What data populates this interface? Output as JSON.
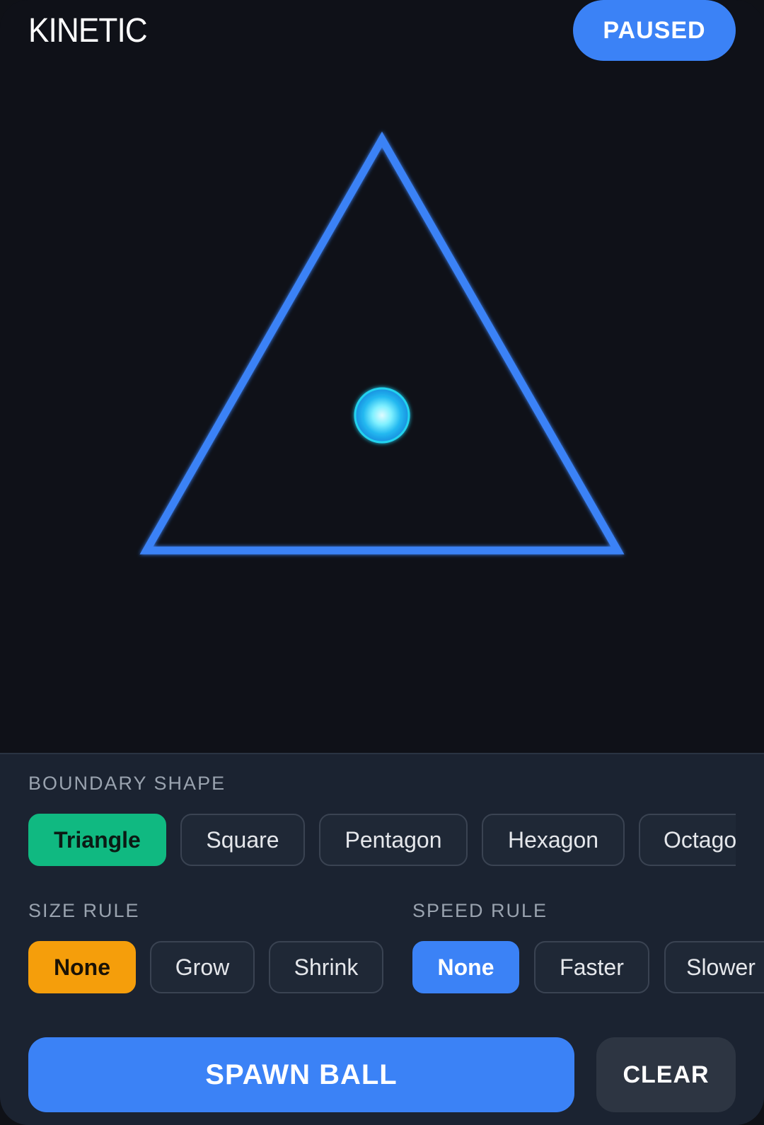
{
  "header": {
    "title": "KINETIC",
    "status": "PAUSED"
  },
  "stage": {
    "boundary_color": "#3b82f6",
    "ball_color": "#38bdf8"
  },
  "boundary_shape": {
    "label": "BOUNDARY SHAPE",
    "options": [
      "Triangle",
      "Square",
      "Pentagon",
      "Hexagon",
      "Octago"
    ],
    "selected": "Triangle"
  },
  "size_rule": {
    "label": "SIZE RULE",
    "options": [
      "None",
      "Grow",
      "Shrink"
    ],
    "selected": "None"
  },
  "speed_rule": {
    "label": "SPEED RULE",
    "options": [
      "None",
      "Faster",
      "Slower"
    ],
    "selected": "None"
  },
  "actions": {
    "spawn_label": "SPAWN BALL",
    "clear_label": "CLEAR"
  },
  "colors": {
    "accent_blue": "#3b82f6",
    "accent_green": "#10b981",
    "accent_orange": "#f59e0b",
    "background": "#0f1118",
    "panel": "#1b2331"
  }
}
